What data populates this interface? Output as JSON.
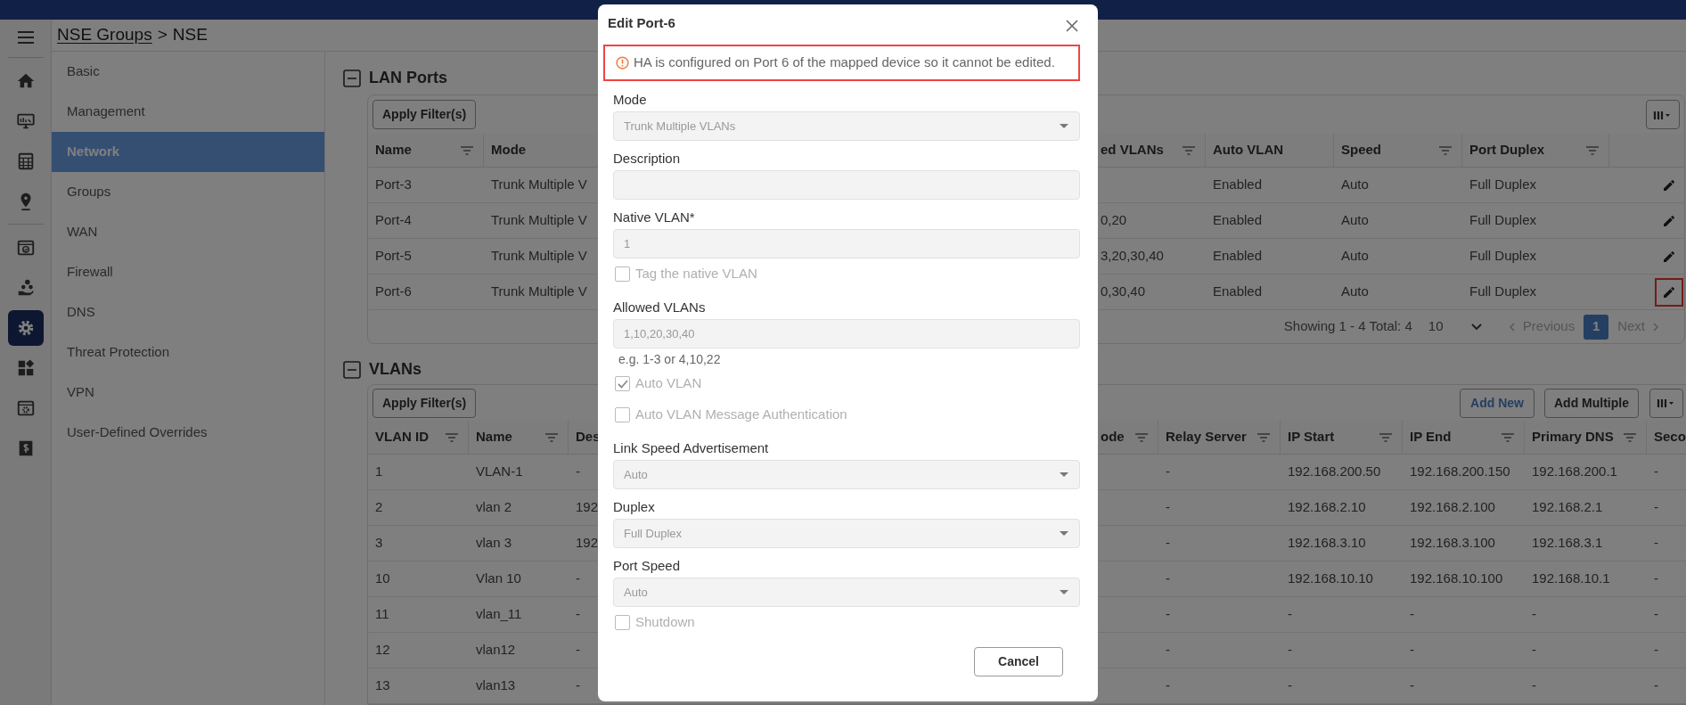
{
  "rail": {
    "menu": {
      "selected": false
    },
    "groups": [
      [
        {
          "kind": "home",
          "selected": false
        },
        {
          "kind": "monitor",
          "selected": false
        },
        {
          "kind": "grid",
          "selected": false
        },
        {
          "kind": "pin",
          "selected": false
        }
      ],
      [
        {
          "kind": "window_check",
          "selected": false
        },
        {
          "kind": "people",
          "selected": false
        },
        {
          "kind": "gear",
          "selected": true
        },
        {
          "kind": "widgets",
          "selected": false
        },
        {
          "kind": "window_gear",
          "selected": false
        },
        {
          "kind": "money",
          "selected": false
        }
      ]
    ]
  },
  "breadcrumb": {
    "link": "NSE Groups",
    "separator": ">",
    "current": "NSE"
  },
  "settings_nav": [
    {
      "label": "Basic",
      "selected": false
    },
    {
      "label": "Management",
      "selected": false
    },
    {
      "label": "Network",
      "selected": true
    },
    {
      "label": "Groups",
      "selected": false
    },
    {
      "label": "WAN",
      "selected": false
    },
    {
      "label": "Firewall",
      "selected": false
    },
    {
      "label": "DNS",
      "selected": false
    },
    {
      "label": "Threat Protection",
      "selected": false
    },
    {
      "label": "VPN",
      "selected": false
    },
    {
      "label": "User-Defined Overrides",
      "selected": false
    }
  ],
  "lan_ports": {
    "title": "LAN Ports",
    "expanded": true,
    "apply_filter": "Apply Filter(s)",
    "columns": [
      {
        "label": "Name",
        "filter": true
      },
      {
        "label": "Mode",
        "filter": false
      },
      {
        "label": "ed VLANs",
        "filter": true
      },
      {
        "label": "Auto VLAN",
        "filter": false
      },
      {
        "label": "Speed",
        "filter": true
      },
      {
        "label": "Port Duplex",
        "filter": true
      }
    ],
    "rows": [
      {
        "cells": [
          "Port-3",
          "Trunk Multiple V",
          null,
          "Enabled",
          "Auto",
          "Full Duplex"
        ],
        "edit_highlighted": false
      },
      {
        "cells": [
          "Port-4",
          "Trunk Multiple V",
          "0,20",
          "Enabled",
          "Auto",
          "Full Duplex"
        ],
        "edit_highlighted": false
      },
      {
        "cells": [
          "Port-5",
          "Trunk Multiple V",
          "3,20,30,40",
          "Enabled",
          "Auto",
          "Full Duplex"
        ],
        "edit_highlighted": false
      },
      {
        "cells": [
          "Port-6",
          "Trunk Multiple V",
          "0,30,40",
          "Enabled",
          "Auto",
          "Full Duplex"
        ],
        "edit_highlighted": true
      }
    ],
    "pagination": {
      "summary": "Showing 1 - 4 Total: 4",
      "page_size": "10",
      "previous": "Previous",
      "pages": [
        {
          "label": "1",
          "selected": true
        }
      ],
      "next": "Next"
    }
  },
  "vlans": {
    "title": "VLANs",
    "expanded": true,
    "apply_filter": "Apply Filter(s)",
    "add_new": "Add New",
    "add_multiple": "Add Multiple",
    "columns": [
      {
        "label": "VLAN ID",
        "filter": true
      },
      {
        "label": "Name",
        "filter": true
      },
      {
        "label": "Des"
      },
      {
        "label": "ode",
        "filter": true
      },
      {
        "label": "Relay Server",
        "filter": true
      },
      {
        "label": "IP Start",
        "filter": true
      },
      {
        "label": "IP End",
        "filter": true
      },
      {
        "label": "Primary DNS",
        "filter": true
      },
      {
        "label": "Seco"
      }
    ],
    "rows": [
      [
        "1",
        "VLAN-1",
        "-",
        null,
        "-",
        "192.168.200.50",
        "192.168.200.150",
        "192.168.200.1",
        "-"
      ],
      [
        "2",
        "vlan 2",
        "192.",
        null,
        "-",
        "192.168.2.10",
        "192.168.2.100",
        "192.168.2.1",
        "-"
      ],
      [
        "3",
        "vlan 3",
        "192.",
        null,
        "-",
        "192.168.3.10",
        "192.168.3.100",
        "192.168.3.1",
        "-"
      ],
      [
        "10",
        "Vlan 10",
        "-",
        null,
        "-",
        "192.168.10.10",
        "192.168.10.100",
        "192.168.10.1",
        "-"
      ],
      [
        "11",
        "vlan_11",
        "-",
        null,
        "-",
        "-",
        "-",
        "-",
        "-"
      ],
      [
        "12",
        "vlan12",
        "-",
        null,
        "-",
        "-",
        "-",
        "-",
        "-"
      ],
      [
        "13",
        "vlan13",
        "-",
        null,
        "-",
        "-",
        "-",
        "-",
        "-"
      ]
    ]
  },
  "dialog": {
    "title": "Edit Port-6",
    "alert": {
      "message": "HA is configured on Port 6 of the mapped device so it cannot be edited.",
      "highlighted": true
    },
    "fields": [
      {
        "kind": "select",
        "label": "Mode",
        "value": "Trunk Multiple VLANs",
        "disabled": true
      },
      {
        "kind": "input",
        "label": "Description",
        "disabled": true
      },
      {
        "kind": "input",
        "label": "Native VLAN*",
        "value": "1",
        "disabled": true
      },
      {
        "kind": "checkbox",
        "label": "Tag the native VLAN",
        "checked": false,
        "disabled": true
      },
      {
        "kind": "input",
        "label": "Allowed VLANs",
        "value": "1,10,20,30,40",
        "hint": "e.g. 1-3 or 4,10,22",
        "disabled": true
      },
      {
        "kind": "checkbox",
        "label": "Auto VLAN",
        "checked": true,
        "disabled": true
      },
      {
        "kind": "checkbox",
        "label": "Auto VLAN Message Authentication",
        "checked": false,
        "disabled": true
      },
      {
        "kind": "select",
        "label": "Link Speed Advertisement",
        "value": "Auto",
        "disabled": true
      },
      {
        "kind": "select",
        "label": "Duplex",
        "value": "Full Duplex",
        "disabled": true
      },
      {
        "kind": "select",
        "label": "Port Speed",
        "value": "Auto",
        "disabled": true
      },
      {
        "kind": "checkbox",
        "label": "Shutdown",
        "checked": false,
        "disabled": true
      }
    ],
    "cancel": "Cancel"
  }
}
